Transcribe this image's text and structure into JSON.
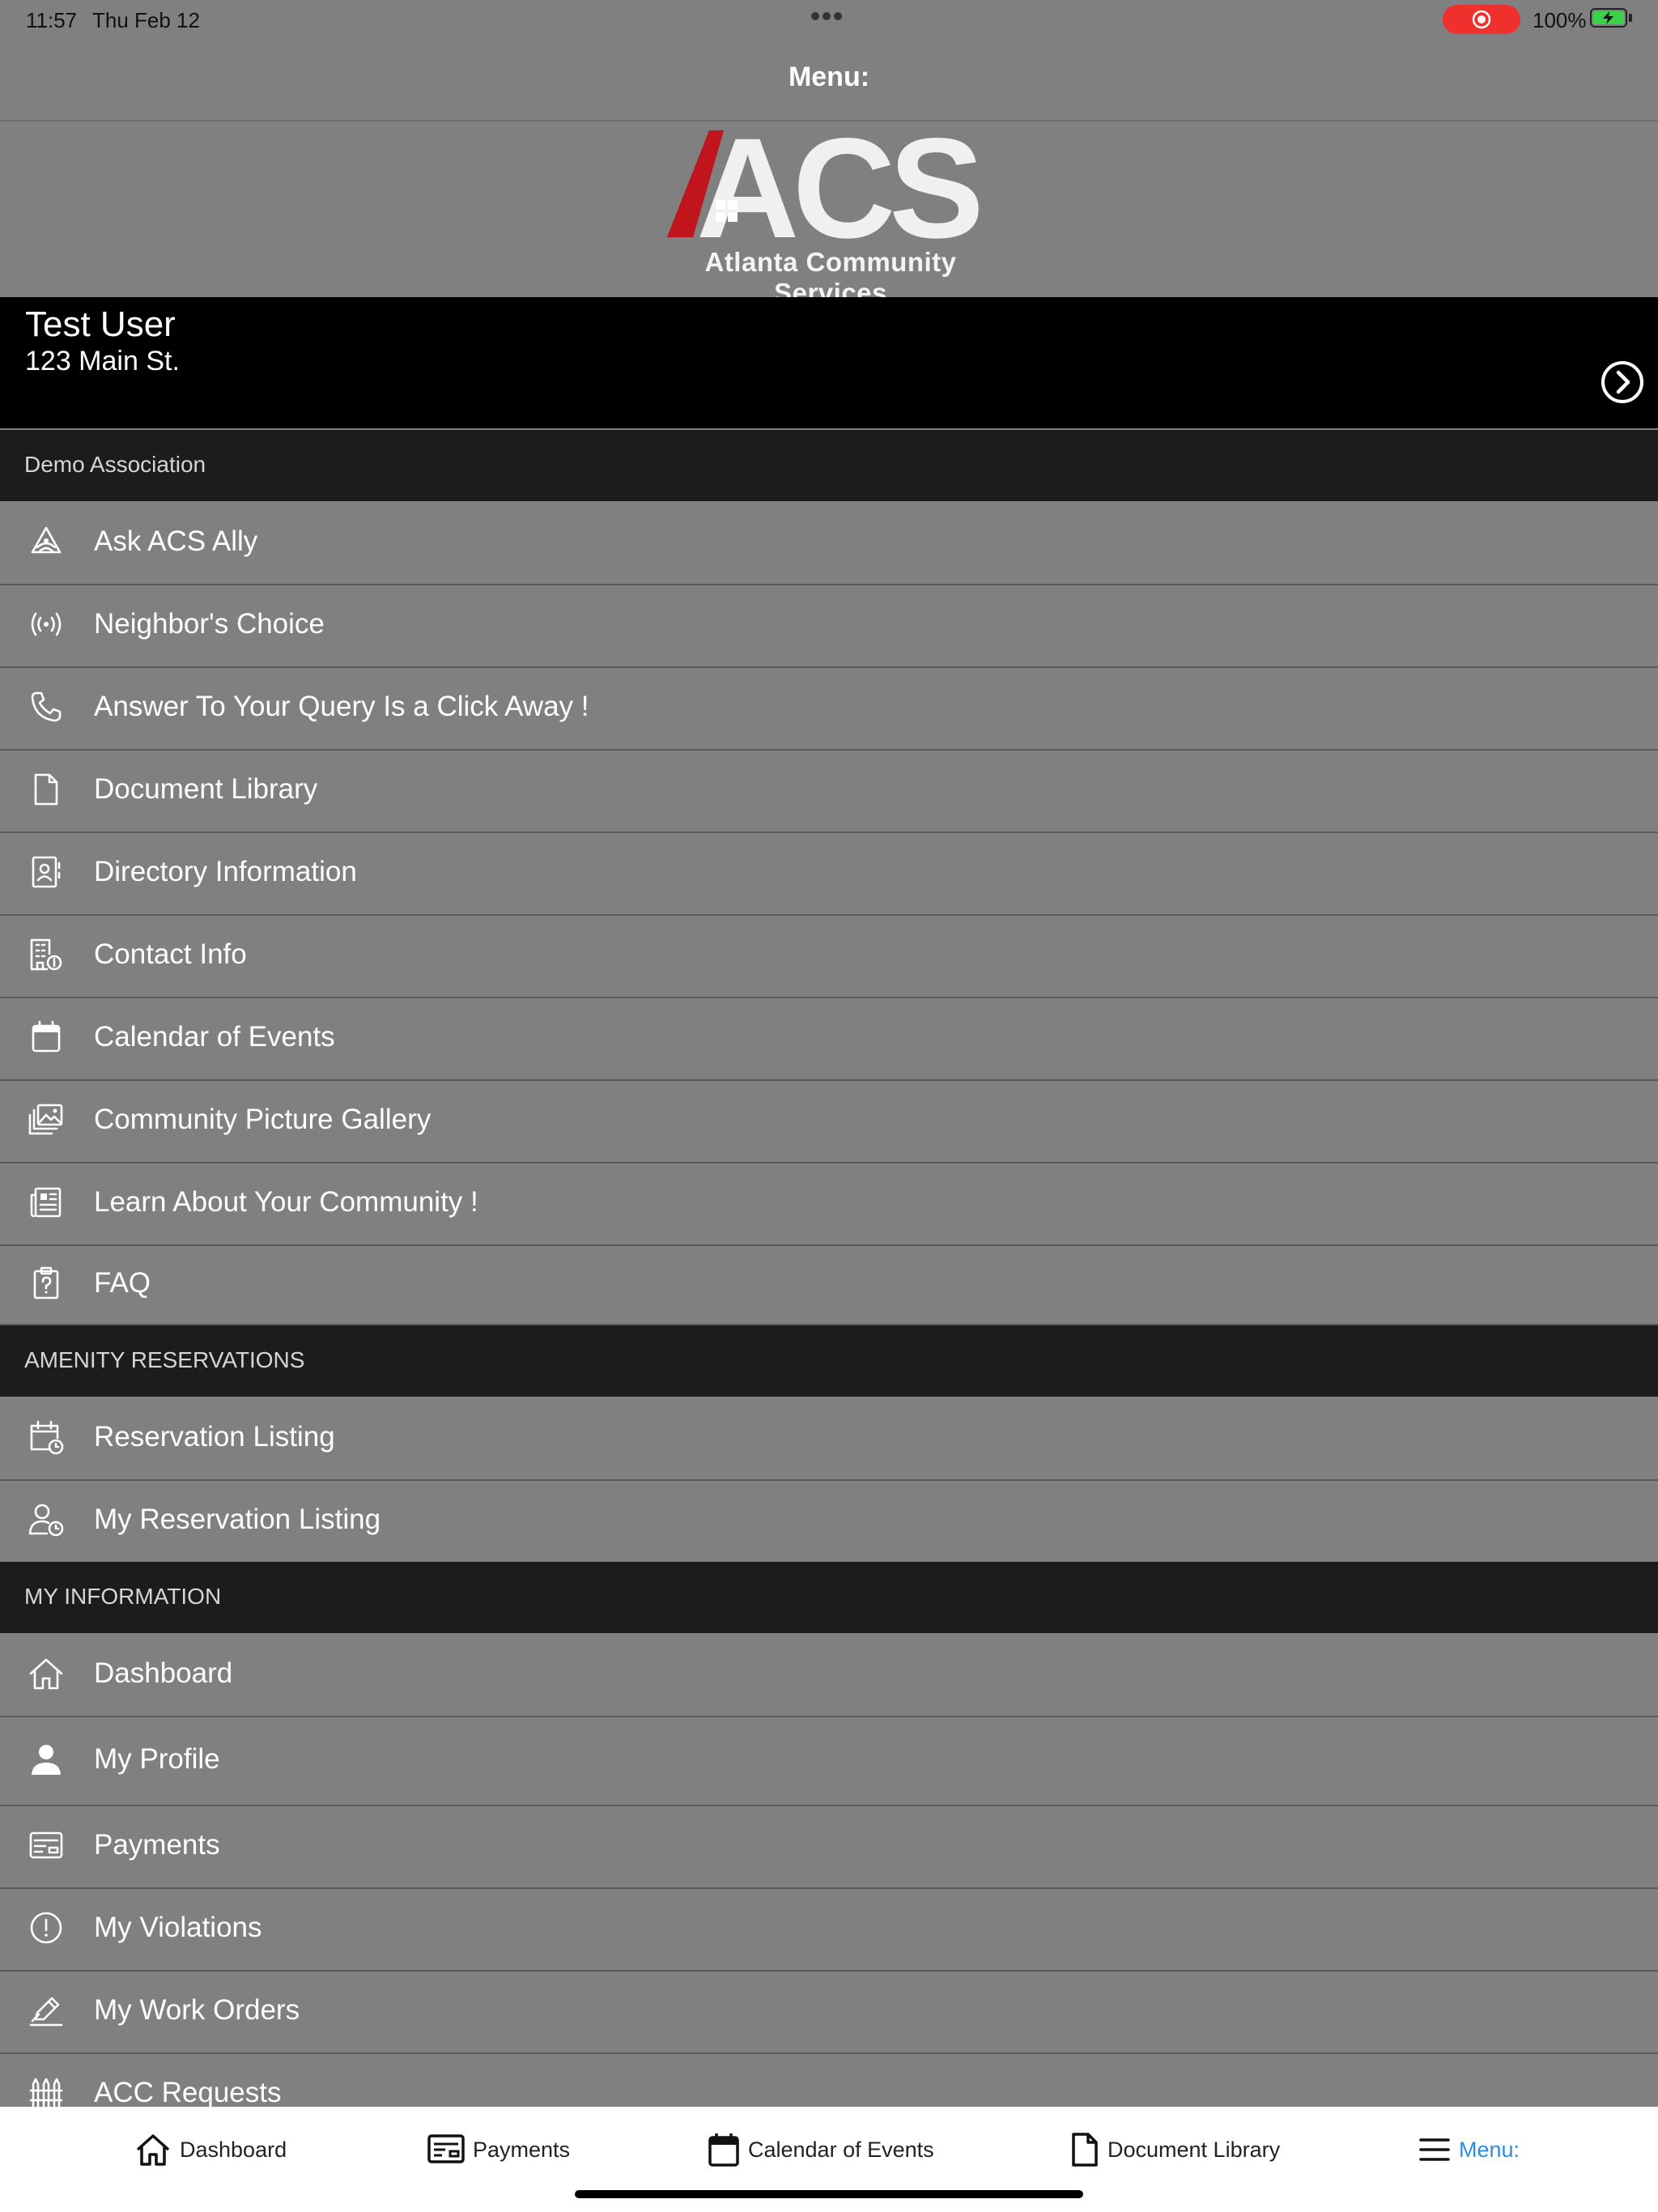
{
  "status_bar": {
    "time": "11:57",
    "date": "Thu Feb 12",
    "battery": "100%",
    "battery_level": 1.0,
    "record_color": "#f0302c"
  },
  "nav": {
    "title": "Menu:"
  },
  "logo": {
    "mark": "ACS",
    "subtitle": "Atlanta Community Services",
    "accent_color": "#c0161c"
  },
  "user": {
    "name": "Test User",
    "address": "123 Main St."
  },
  "sections": [
    {
      "label": "Demo Association",
      "items": [
        {
          "label": "Ask ACS Ally",
          "icon": "ally-icon"
        },
        {
          "label": "Neighbor's Choice",
          "icon": "broadcast-icon"
        },
        {
          "label": "Answer To Your Query Is a Click Away !",
          "icon": "phone-icon"
        },
        {
          "label": "Document Library",
          "icon": "document-icon"
        },
        {
          "label": "Directory Information",
          "icon": "contact-card-icon"
        },
        {
          "label": "Contact Info",
          "icon": "building-info-icon"
        },
        {
          "label": "Calendar of Events",
          "icon": "calendar-icon"
        },
        {
          "label": "Community Picture Gallery",
          "icon": "gallery-icon"
        },
        {
          "label": "Learn About Your Community !",
          "icon": "newspaper-icon"
        },
        {
          "label": "FAQ",
          "icon": "clipboard-question-icon"
        }
      ]
    },
    {
      "label": "AMENITY RESERVATIONS",
      "items": [
        {
          "label": "Reservation Listing",
          "icon": "calendar-clock-icon"
        },
        {
          "label": "My Reservation Listing",
          "icon": "user-clock-icon"
        }
      ]
    },
    {
      "label": "MY INFORMATION",
      "items": [
        {
          "label": "Dashboard",
          "icon": "home-icon"
        },
        {
          "label": "My Profile",
          "icon": "person-icon"
        },
        {
          "label": "Payments",
          "icon": "payment-card-icon"
        },
        {
          "label": "My Violations",
          "icon": "alert-circle-icon"
        },
        {
          "label": "My Work Orders",
          "icon": "pencil-icon"
        },
        {
          "label": "ACC Requests",
          "icon": "fence-icon"
        }
      ]
    }
  ],
  "tabbar": {
    "active_color": "#2c8ee0",
    "tabs": [
      {
        "label": "Dashboard",
        "icon": "home-icon"
      },
      {
        "label": "Payments",
        "icon": "payment-card-icon"
      },
      {
        "label": "Calendar of Events",
        "icon": "calendar-icon"
      },
      {
        "label": "Document Library",
        "icon": "document-icon"
      },
      {
        "label": "Menu:",
        "icon": "menu-icon",
        "active": true
      }
    ]
  }
}
